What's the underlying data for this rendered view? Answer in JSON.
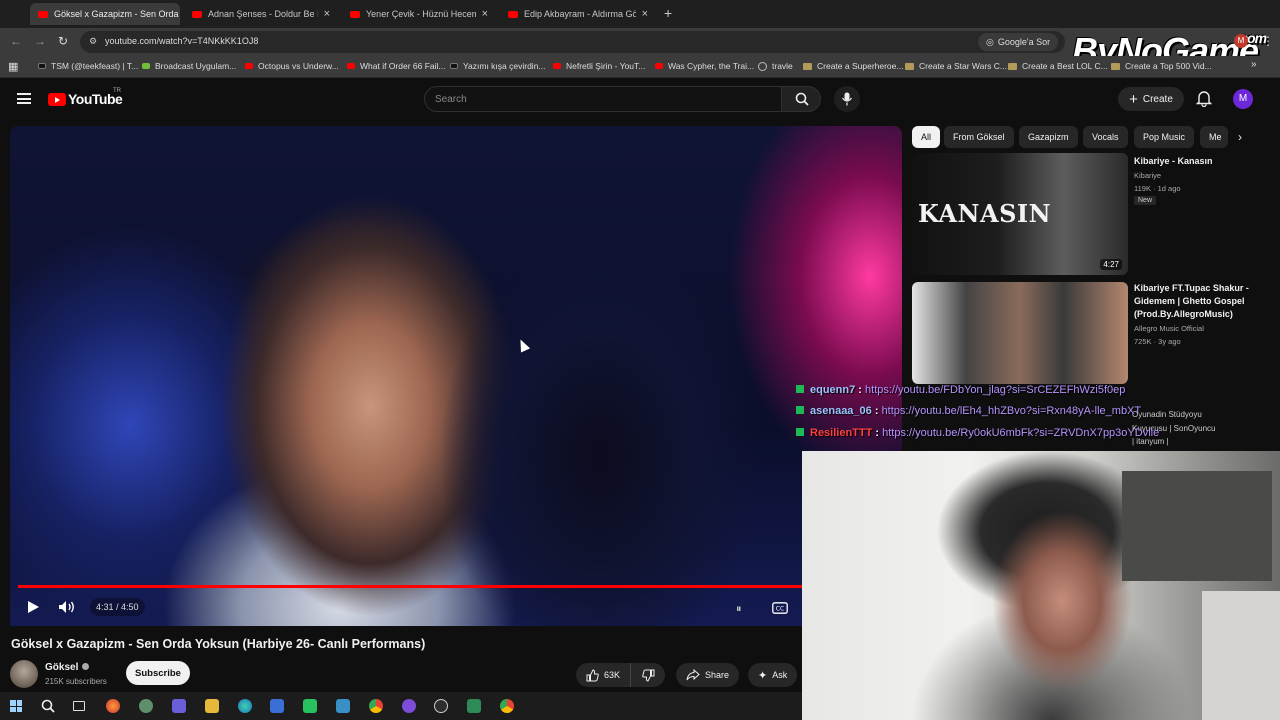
{
  "tabs": [
    {
      "label": "Göksel x Gazapizm - Sen Orda Yoksun",
      "active": true
    },
    {
      "label": "Adnan Şenses - Doldur Be Meyhaneci",
      "active": false
    },
    {
      "label": "Yener Çevik - Hüznü Hecem (Prod.",
      "active": false
    },
    {
      "label": "Edip Akbayram - Aldırma Gönül",
      "active": false
    }
  ],
  "address": {
    "url": "youtube.com/watch?v=T4NKkKK1OJ8",
    "google_button": "Google'a Sor",
    "watermark": "ByNoGame",
    "watermark_suffix": ".com",
    "profile_initial": "M"
  },
  "bookmarks": [
    {
      "label": "TSM (@teekfeast) | T...",
      "icon": "tiktok"
    },
    {
      "label": "Broadcast Uygulam...",
      "icon": "green"
    },
    {
      "label": "Octopus vs Underw...",
      "icon": "youtube"
    },
    {
      "label": "What if Order 66 Fail...",
      "icon": "youtube"
    },
    {
      "label": "Yazımı kışa çevirdin...",
      "icon": "tiktok"
    },
    {
      "label": "Nefretli Şirin - YouT...",
      "icon": "youtube"
    },
    {
      "label": "Was Cypher, the Trai...",
      "icon": "youtube"
    },
    {
      "label": "travle",
      "icon": "globe"
    },
    {
      "label": "Create a Superheroe...",
      "icon": "folder"
    },
    {
      "label": "Create a Star Wars C...",
      "icon": "folder"
    },
    {
      "label": "Create a Best LOL C...",
      "icon": "folder"
    },
    {
      "label": "Create a Top 500 Vid...",
      "icon": "folder"
    }
  ],
  "youtube": {
    "logo": "YouTube",
    "region": "TR",
    "search_placeholder": "Search",
    "create_label": "Create",
    "avatar_initial": "M"
  },
  "player": {
    "time": "4:31 / 4:50",
    "progress": 0.938
  },
  "video": {
    "title": "Göksel x Gazapizm - Sen Orda Yoksun (Harbiye 26- Canlı Performans)",
    "channel": "Göksel",
    "subscribers": "215K subscribers",
    "subscribe_label": "Subscribe",
    "likes": "63K",
    "share_label": "Share",
    "ask_label": "Ask"
  },
  "chips": [
    "All",
    "From Göksel",
    "Gazapizm",
    "Vocals",
    "Pop Music",
    "Me"
  ],
  "recommendations": [
    {
      "title": "Kibariye - Kanasın",
      "channel": "Kibariye",
      "meta": "119K · 1d ago",
      "badge": "New",
      "duration": "4:27",
      "thumb_text": "KANASIN"
    },
    {
      "title": "Kibariye FT.Tupac Shakur - Gidemem | Ghetto Gospel (Prod.By.AllegroMusic)",
      "channel": "Allegro Music Official",
      "meta": "725K · 3y ago"
    }
  ],
  "chat": [
    {
      "user": "equenn7",
      "message": "https://youtu.be/FDbYon_jlag?si=SrCEZEFhWzi5f0ep"
    },
    {
      "user": "asenaaa_06",
      "message": "https://youtu.be/lEh4_hhZBvo?si=Rxn48yA-lle_mbXT"
    },
    {
      "user": "ResilienTTT",
      "message": "https://youtu.be/Ry0okU6mbFk?si=ZRVDnX7pp3oYDvlle"
    }
  ],
  "ghost_text": [
    "Oyunadin Stüdyoyu",
    "Kuyucusu | SonOyuncu",
    "| itanyum |"
  ]
}
